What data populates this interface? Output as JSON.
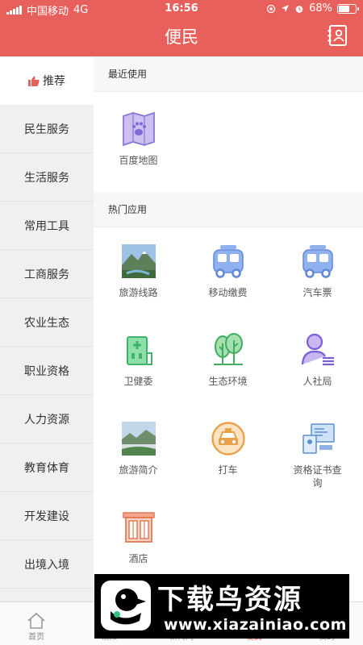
{
  "status_bar": {
    "carrier": "中国移动",
    "network": "4G",
    "time": "16:56",
    "battery": "68%",
    "battery_level": 0.68
  },
  "header": {
    "title": "便民",
    "icon": "contact-book-icon",
    "bg_color": "#e8605c"
  },
  "sidebar": {
    "items": [
      {
        "label": "推荐",
        "active": true
      },
      {
        "label": "民生服务"
      },
      {
        "label": "生活服务"
      },
      {
        "label": "常用工具"
      },
      {
        "label": "工商服务"
      },
      {
        "label": "农业生态"
      },
      {
        "label": "职业资格"
      },
      {
        "label": "人力资源"
      },
      {
        "label": "教育体育"
      },
      {
        "label": "开发建设"
      },
      {
        "label": "出境入境"
      }
    ]
  },
  "recent": {
    "title": "最近使用",
    "apps": [
      {
        "label": "百度地图",
        "icon": "map-paw-icon"
      }
    ]
  },
  "hot": {
    "title": "热门应用",
    "apps": [
      {
        "label": "旅游线路",
        "icon": "mountain-photo-icon"
      },
      {
        "label": "移动缴费",
        "icon": "bus-icon"
      },
      {
        "label": "汽车票",
        "icon": "bus-icon"
      },
      {
        "label": "卫健委",
        "icon": "hospital-icon"
      },
      {
        "label": "生态环境",
        "icon": "trees-icon"
      },
      {
        "label": "人社局",
        "icon": "person-card-icon"
      },
      {
        "label": "旅游简介",
        "icon": "landscape-photo-icon"
      },
      {
        "label": "打车",
        "icon": "taxi-icon"
      },
      {
        "label": "资格证书查询",
        "icon": "certificate-icon"
      },
      {
        "label": "酒店",
        "icon": "hotel-icon"
      }
    ]
  },
  "tabbar": {
    "items": [
      {
        "label": "首页",
        "icon": "home-icon"
      },
      {
        "label": "视频"
      },
      {
        "label": "新闻网"
      },
      {
        "label": "便民",
        "active": true
      },
      {
        "label": "我的"
      }
    ]
  },
  "watermark": {
    "title": "下载鸟资源",
    "url": "www.xiazainiao.com"
  }
}
